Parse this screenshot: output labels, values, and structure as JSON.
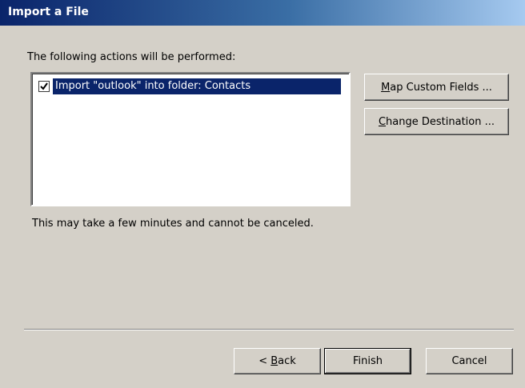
{
  "window": {
    "title": "Import a File"
  },
  "actions_label": "The following actions will be performed:",
  "actions": [
    {
      "label": "Import \"outlook\" into folder: Contacts",
      "checked": true
    }
  ],
  "side_buttons": {
    "map_fields": {
      "prefix": "",
      "accel": "M",
      "rest": "ap Custom Fields ..."
    },
    "change_dest": {
      "prefix": "",
      "accel": "C",
      "rest": "hange Destination ..."
    }
  },
  "note": "This may take a few minutes and cannot be canceled.",
  "footer": {
    "back": {
      "prefix": "< ",
      "accel": "B",
      "rest": "ack"
    },
    "finish": "Finish",
    "cancel": "Cancel"
  },
  "colors": {
    "title_bar": "#0a246a",
    "selection": "#0a246a",
    "dialog_bg": "#d4d0c8"
  },
  "icons": {
    "checkbox": "checkmark-icon"
  }
}
